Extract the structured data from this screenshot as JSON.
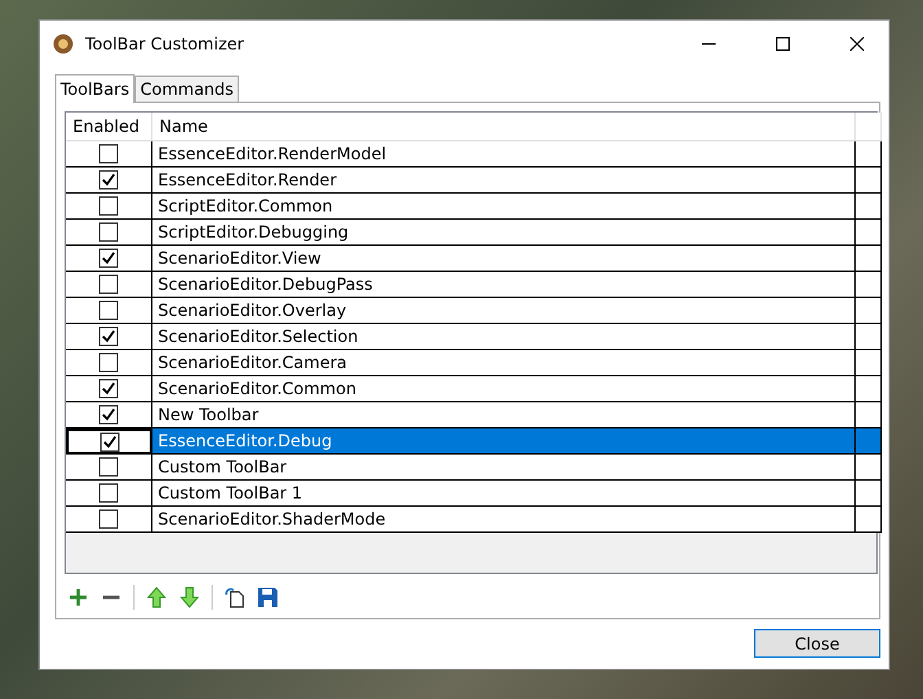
{
  "window": {
    "title": "ToolBar Customizer"
  },
  "tabs": [
    {
      "label": "ToolBars",
      "selected": true
    },
    {
      "label": "Commands",
      "selected": false
    }
  ],
  "table": {
    "columns": [
      "Enabled",
      "Name"
    ],
    "rows": [
      {
        "name": "EssenceEditor.RenderModel",
        "enabled": false,
        "selected": false
      },
      {
        "name": "EssenceEditor.Render",
        "enabled": true,
        "selected": false
      },
      {
        "name": "ScriptEditor.Common",
        "enabled": false,
        "selected": false
      },
      {
        "name": "ScriptEditor.Debugging",
        "enabled": false,
        "selected": false
      },
      {
        "name": "ScenarioEditor.View",
        "enabled": true,
        "selected": false
      },
      {
        "name": "ScenarioEditor.DebugPass",
        "enabled": false,
        "selected": false
      },
      {
        "name": "ScenarioEditor.Overlay",
        "enabled": false,
        "selected": false
      },
      {
        "name": "ScenarioEditor.Selection",
        "enabled": true,
        "selected": false
      },
      {
        "name": "ScenarioEditor.Camera",
        "enabled": false,
        "selected": false
      },
      {
        "name": "ScenarioEditor.Common",
        "enabled": true,
        "selected": false
      },
      {
        "name": "New Toolbar",
        "enabled": true,
        "selected": false
      },
      {
        "name": "EssenceEditor.Debug",
        "enabled": true,
        "selected": true
      },
      {
        "name": "Custom ToolBar",
        "enabled": false,
        "selected": false
      },
      {
        "name": "Custom ToolBar 1",
        "enabled": false,
        "selected": false
      },
      {
        "name": "ScenarioEditor.ShaderMode",
        "enabled": false,
        "selected": false
      }
    ]
  },
  "buttons": [
    {
      "label": "Close"
    }
  ]
}
